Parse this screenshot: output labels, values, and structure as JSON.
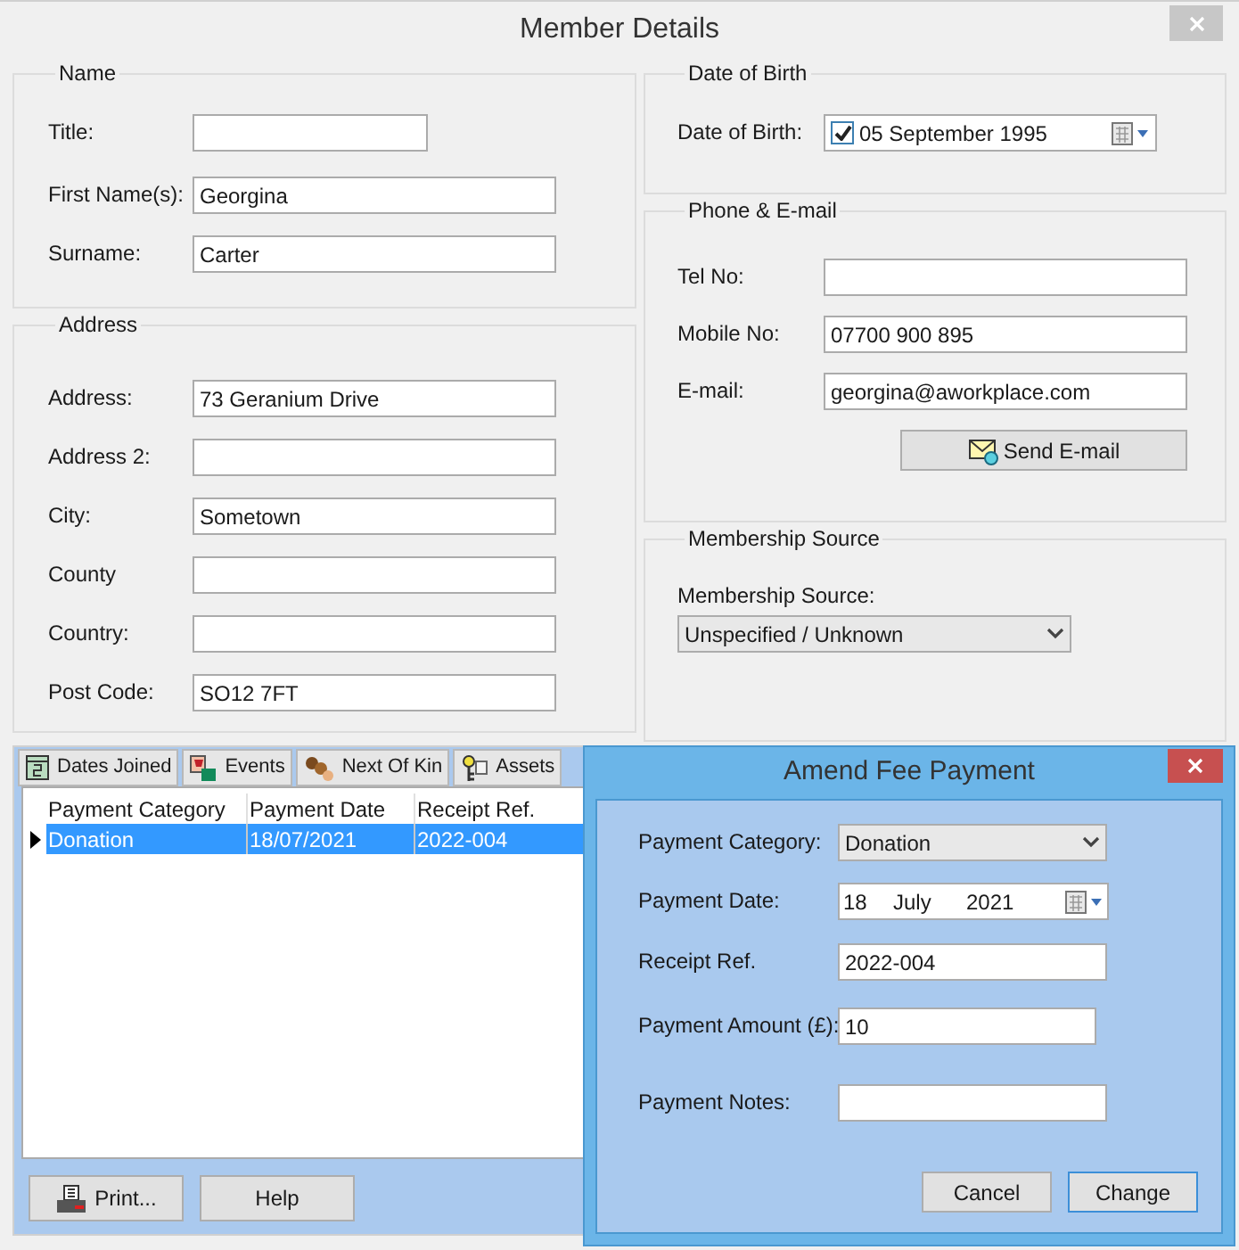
{
  "window": {
    "title": "Member Details"
  },
  "name_group": {
    "title": "Name",
    "fields": [
      {
        "label": "Title:"
      },
      {
        "label": "First Name(s):",
        "value": "Georgina"
      },
      {
        "label": "Surname:",
        "value": "Carter"
      }
    ]
  },
  "address_group": {
    "title": "Address",
    "fields": [
      {
        "label": "Address:",
        "value": "73 Geranium Drive"
      },
      {
        "label": "Address 2:"
      },
      {
        "label": "City:",
        "value": "Sometown"
      },
      {
        "label": "County"
      },
      {
        "label": "Country:"
      },
      {
        "label": "Post Code:",
        "value": "SO12 7FT"
      }
    ]
  },
  "birth_group": {
    "title": "Date of Birth",
    "label": "Date of Birth:",
    "checked": true,
    "value": "05 September 1995"
  },
  "contact_group": {
    "title": "Phone & E-mail",
    "fields": [
      {
        "label": "Tel No:"
      },
      {
        "label": "Mobile No:",
        "value": "07700 900 895"
      },
      {
        "label": "E-mail:",
        "value": "georgina@aworkplace.com"
      }
    ],
    "button": "Send E-mail"
  },
  "source_group": {
    "title": "Membership Source",
    "label": "Membership Source:",
    "value": "Unspecified / Unknown"
  },
  "tabs": [
    {
      "label": "Dates Joined"
    },
    {
      "label": "Events"
    },
    {
      "label": "Next Of Kin"
    },
    {
      "label": "Assets"
    }
  ],
  "table": {
    "columns": [
      "Payment Category",
      "Payment Date",
      "Receipt Ref."
    ],
    "rows": [
      {
        "cells": [
          "Donation",
          "18/07/2021",
          "2022-004"
        ],
        "selected": true
      }
    ]
  },
  "buttons": [
    {
      "label": "Print..."
    },
    {
      "label": "Help"
    }
  ],
  "dialog": {
    "title": "Amend Fee Payment",
    "fields": [
      {
        "kind": "select",
        "label": "Payment Category:",
        "value": "Donation"
      },
      {
        "kind": "date",
        "label": "Payment Date:",
        "day": "18",
        "month": "July",
        "year": "2021"
      },
      {
        "kind": "text",
        "label": "Receipt Ref.",
        "value": "2022-004"
      },
      {
        "kind": "amount",
        "label": "Payment Amount (£):",
        "value": "10"
      },
      {
        "kind": "text",
        "label": "Payment Notes:"
      }
    ],
    "buttons": [
      {
        "label": "Cancel",
        "default": false
      },
      {
        "label": "Change",
        "default": true
      }
    ]
  }
}
